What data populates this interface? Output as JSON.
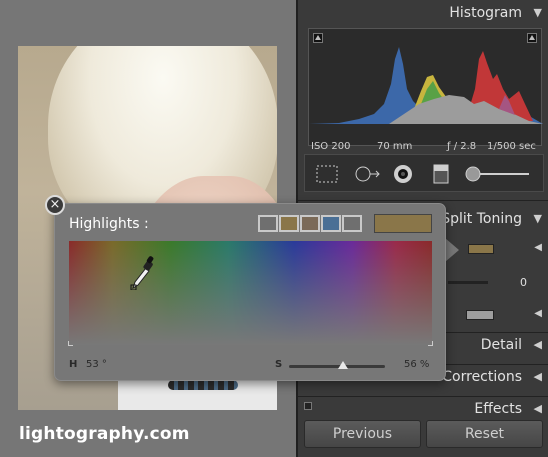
{
  "watermark": "lightography.com",
  "panels": {
    "histogram": "Histogram",
    "split_toning": "Split Toning",
    "detail": "Detail",
    "lens_corrections": "Lens Corrections",
    "effects": "Effects"
  },
  "exif": {
    "iso": "ISO 200",
    "focal": "70 mm",
    "aperture": "ƒ / 2.8",
    "shutter": "1/500 sec"
  },
  "split_toning": {
    "balance_value": "0"
  },
  "buttons": {
    "previous": "Previous",
    "reset": "Reset"
  },
  "popup": {
    "title": "Highlights :",
    "hue_label": "H",
    "hue_value": "53 °",
    "sat_label": "S",
    "sat_value": "56 %",
    "saturation_fraction": 0.56,
    "current_color": "#8a7649",
    "swatch_colors": [
      "#6f6f6f",
      "#8a7649",
      "#7b6a58",
      "#4a6f95",
      "#6f6f6f"
    ]
  },
  "close_glyph": "×"
}
